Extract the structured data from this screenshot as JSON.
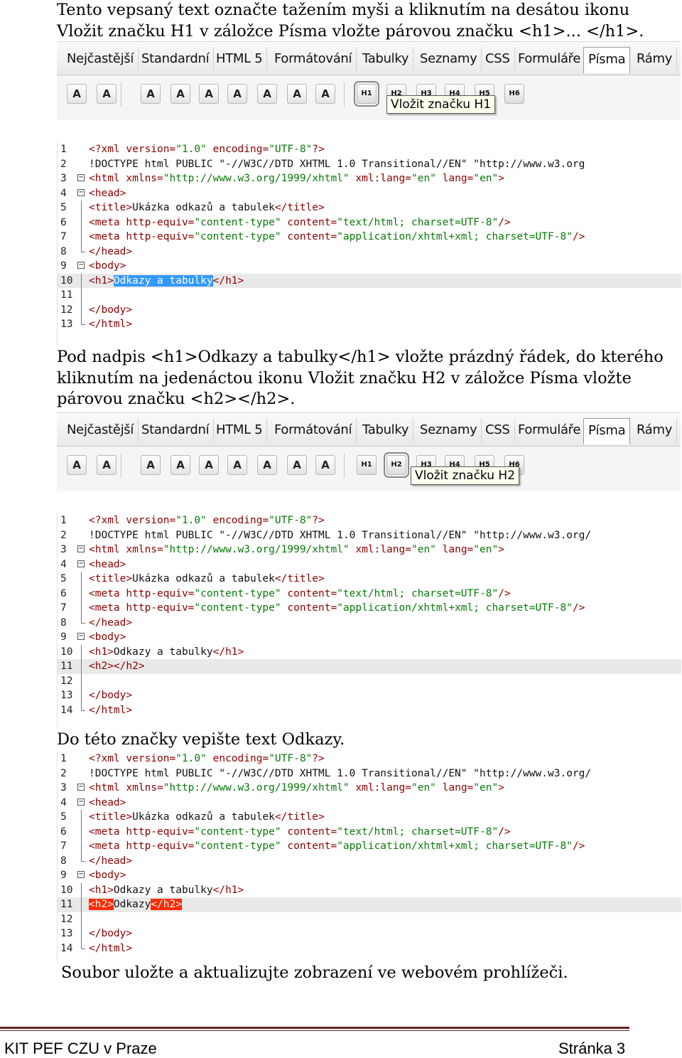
{
  "paragraphs": {
    "p1": "Tento vepsaný text označte tažením myši a kliknutím na desátou ikonu Vložit značku H1 v záložce Písma vložte párovou značku <h1>... </h1>.",
    "p2": "Pod nadpis <h1>Odkazy a tabulky</h1> vložte prázdný řádek, do kterého kliknutím na jedenáctou ikonu Vložit značku H2 v záložce Písma vložte párovou značku <h2></h2>.",
    "p3": "Do této značky vepište text Odkazy.",
    "p4": "Soubor uložte a aktualizujte zobrazení ve webovém prohlížeči."
  },
  "toolbar": {
    "tabs": [
      "Nejčastější",
      "Standardní",
      "HTML 5",
      "Formátování",
      "Tabulky",
      "Seznamy",
      "CSS",
      "Formuláře",
      "Písma",
      "Rámy"
    ],
    "active_tab": "Písma",
    "font_buttons": [
      "A",
      "A",
      "A",
      "A",
      "A",
      "A",
      "A",
      "A",
      "A"
    ],
    "heading_buttons": [
      "H1",
      "H2",
      "H3",
      "H4",
      "H5",
      "H6"
    ],
    "tooltip1": "Vložit značku H1",
    "tooltip2": "Vložit značku H2"
  },
  "code1": {
    "lines": [
      {
        "n": "1",
        "text": "<?xml version=\"1.0\" encoding=\"UTF-8\"?>"
      },
      {
        "n": "2",
        "text": "<!DOCTYPE html PUBLIC \"-//W3C//DTD XHTML 1.0 Transitional//EN\" \"http://www.w3.org"
      },
      {
        "n": "3",
        "text": "<html xmlns=\"http://www.w3.org/1999/xhtml\" xml:lang=\"en\" lang=\"en\">"
      },
      {
        "n": "4",
        "text": "<head>"
      },
      {
        "n": "5",
        "text": "<title>Ukázka odkazů a tabulek</title>"
      },
      {
        "n": "6",
        "text": "<meta http-equiv=\"content-type\" content=\"text/html; charset=UTF-8\"/>"
      },
      {
        "n": "7",
        "text": "<meta http-equiv=\"content-type\" content=\"application/xhtml+xml; charset=UTF-8\"/>"
      },
      {
        "n": "8",
        "text": "</head>"
      },
      {
        "n": "9",
        "text": "<body>"
      },
      {
        "n": "10",
        "pre": "<h1>",
        "hl": "Odkazy a tabulky",
        "post": "</h1>"
      },
      {
        "n": "11",
        "text": ""
      },
      {
        "n": "12",
        "text": "</body>"
      },
      {
        "n": "13",
        "text": "</html>"
      }
    ]
  },
  "code2": {
    "lines": [
      {
        "n": "1",
        "text": "<?xml version=\"1.0\" encoding=\"UTF-8\"?>"
      },
      {
        "n": "2",
        "text": "<!DOCTYPE html PUBLIC \"-//W3C//DTD XHTML 1.0 Transitional//EN\" \"http://www.w3.org/"
      },
      {
        "n": "3",
        "text": "<html xmlns=\"http://www.w3.org/1999/xhtml\" xml:lang=\"en\" lang=\"en\">"
      },
      {
        "n": "4",
        "text": "<head>"
      },
      {
        "n": "5",
        "text": "<title>Ukázka odkazů a tabulek</title>"
      },
      {
        "n": "6",
        "text": "<meta http-equiv=\"content-type\" content=\"text/html; charset=UTF-8\"/>"
      },
      {
        "n": "7",
        "text": "<meta http-equiv=\"content-type\" content=\"application/xhtml+xml; charset=UTF-8\"/>"
      },
      {
        "n": "8",
        "text": "</head>"
      },
      {
        "n": "9",
        "text": "<body>"
      },
      {
        "n": "10",
        "text": "<h1>Odkazy a tabulky</h1>"
      },
      {
        "n": "11",
        "text": "<h2></h2>"
      },
      {
        "n": "12",
        "text": ""
      },
      {
        "n": "13",
        "text": "</body>"
      },
      {
        "n": "14",
        "text": "</html>"
      }
    ]
  },
  "code3": {
    "lines": [
      {
        "n": "1",
        "text": "<?xml version=\"1.0\" encoding=\"UTF-8\"?>"
      },
      {
        "n": "2",
        "text": "<!DOCTYPE html PUBLIC \"-//W3C//DTD XHTML 1.0 Transitional//EN\" \"http://www.w3.org/"
      },
      {
        "n": "3",
        "text": "<html xmlns=\"http://www.w3.org/1999/xhtml\" xml:lang=\"en\" lang=\"en\">"
      },
      {
        "n": "4",
        "text": "<head>"
      },
      {
        "n": "5",
        "text": "<title>Ukázka odkazů a tabulek</title>"
      },
      {
        "n": "6",
        "text": "<meta http-equiv=\"content-type\" content=\"text/html; charset=UTF-8\"/>"
      },
      {
        "n": "7",
        "text": "<meta http-equiv=\"content-type\" content=\"application/xhtml+xml; charset=UTF-8\"/>"
      },
      {
        "n": "8",
        "text": "</head>"
      },
      {
        "n": "9",
        "text": "<body>"
      },
      {
        "n": "10",
        "text": "<h1>Odkazy a tabulky</h1>"
      },
      {
        "n": "11",
        "pre": "",
        "hlr1": "<h2>",
        "mid": "Odkazy",
        "hlr2": "</h2>"
      },
      {
        "n": "12",
        "text": ""
      },
      {
        "n": "13",
        "text": "</body>"
      },
      {
        "n": "14",
        "text": "</html>"
      }
    ]
  },
  "footer": {
    "left": "KIT PEF CZU v Praze",
    "right": "Stránka 3"
  }
}
